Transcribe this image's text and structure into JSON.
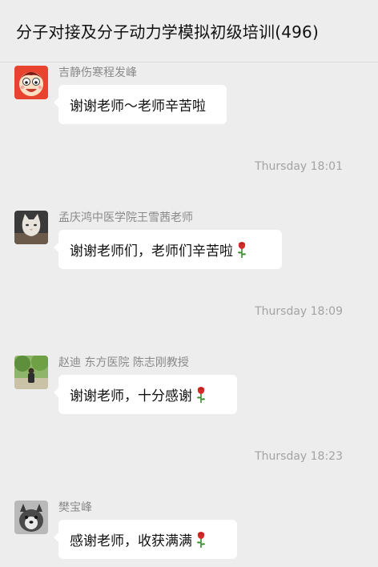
{
  "header": {
    "title": "分子对接及分子动力学模拟初级培训(496)"
  },
  "messages": [
    {
      "sender": "吉静伤寒程发峰",
      "text": "谢谢老师～老师辛苦啦",
      "emoji": ""
    },
    {
      "sender": "孟庆鸿中医学院王雪茜老师",
      "text": "谢谢老师们，老师们辛苦啦",
      "emoji": "rose-icon"
    },
    {
      "sender": "赵迪 东方医院 陈志刚教授",
      "text": "谢谢老师，十分感谢",
      "emoji": "rose-icon"
    },
    {
      "sender": "樊宝峰",
      "text": "感谢老师，收获满满",
      "emoji": "rose-icon"
    }
  ],
  "timestamps": [
    "Thursday 18:01",
    "Thursday 18:09",
    "Thursday 18:23"
  ]
}
